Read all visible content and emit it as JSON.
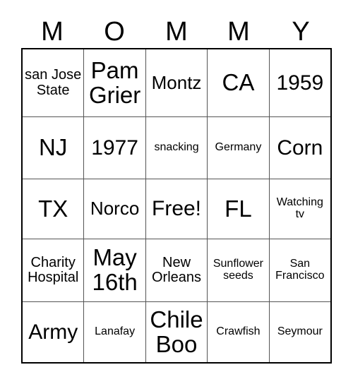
{
  "card": {
    "title": "MOMMY",
    "header_letters": [
      "M",
      "O",
      "M",
      "M",
      "Y"
    ],
    "free_space_label": "Free!",
    "colors": {
      "background": "#ffffff",
      "text": "#000000",
      "outer_border": "#000000",
      "inner_grid_line": "#555555"
    },
    "grid_size": "5x5",
    "rows": [
      [
        {
          "text": "san Jose State"
        },
        {
          "text": "Pam Grier"
        },
        {
          "text": "Montz"
        },
        {
          "text": "CA"
        },
        {
          "text": "1959"
        }
      ],
      [
        {
          "text": "NJ"
        },
        {
          "text": "1977"
        },
        {
          "text": "snacking"
        },
        {
          "text": "Germany"
        },
        {
          "text": "Corn"
        }
      ],
      [
        {
          "text": "TX"
        },
        {
          "text": "Norco"
        },
        {
          "text": "Free!"
        },
        {
          "text": "FL"
        },
        {
          "text": "Watching tv"
        }
      ],
      [
        {
          "text": "Charity Hospital"
        },
        {
          "text": "May 16th"
        },
        {
          "text": "New Orleans"
        },
        {
          "text": "Sunflower seeds"
        },
        {
          "text": "San Francisco"
        }
      ],
      [
        {
          "text": "Army"
        },
        {
          "text": "Lanafay"
        },
        {
          "text": "Chile Boo"
        },
        {
          "text": "Crawfish"
        },
        {
          "text": "Seymour"
        }
      ]
    ]
  }
}
